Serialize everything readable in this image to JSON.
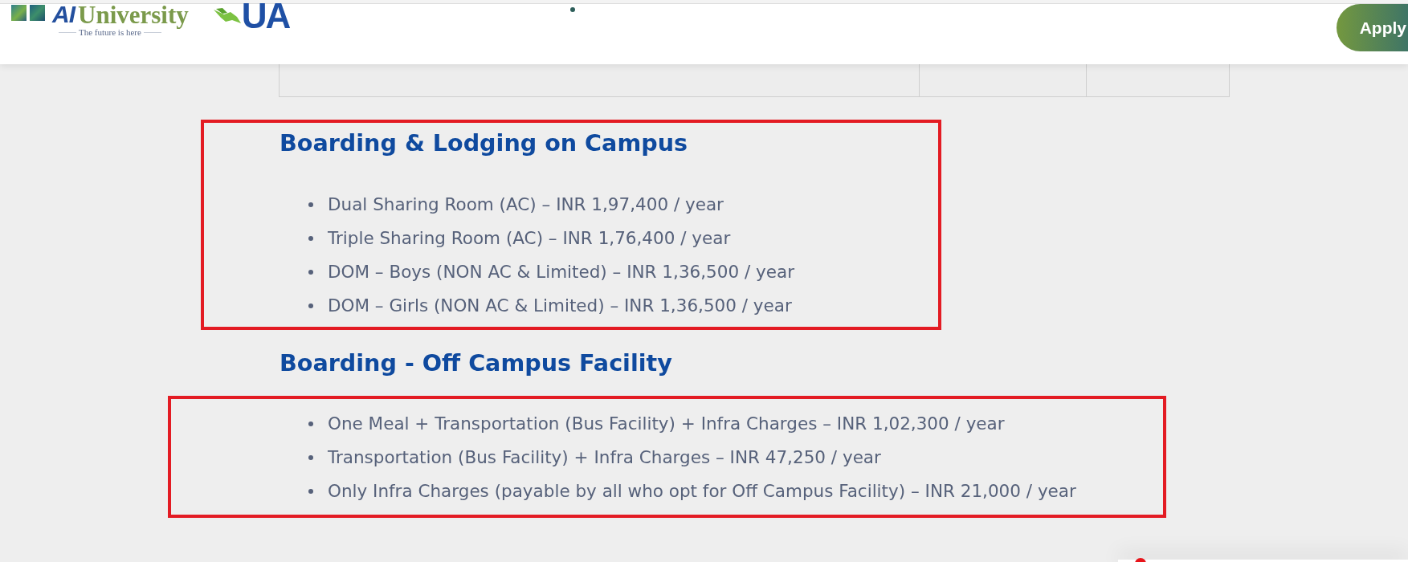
{
  "header": {
    "logo": {
      "mark": "AI",
      "name": "University",
      "tagline": "The future is here"
    },
    "partner_logo": {
      "text": "UA"
    },
    "apply_button": "Apply"
  },
  "sections": [
    {
      "title": "Boarding & Lodging on Campus",
      "framed": true,
      "heading_in_frame": true,
      "items": [
        "Dual Sharing Room (AC) – INR 1,97,400 / year",
        "Triple Sharing Room (AC) – INR 1,76,400 / year",
        "DOM – Boys (NON AC & Limited) – INR 1,36,500 / year",
        "DOM – Girls (NON AC & Limited) – INR 1,36,500 / year"
      ]
    },
    {
      "title": "Boarding - Off Campus Facility",
      "framed": true,
      "heading_in_frame": false,
      "items": [
        "One Meal + Transportation (Bus Facility) + Infra Charges – INR 1,02,300 / year",
        "Transportation (Bus Facility) + Infra Charges – INR 47,250 / year",
        "Only Infra Charges (payable by all who opt for Off Campus Facility) – INR 21,000 / year"
      ]
    }
  ]
}
